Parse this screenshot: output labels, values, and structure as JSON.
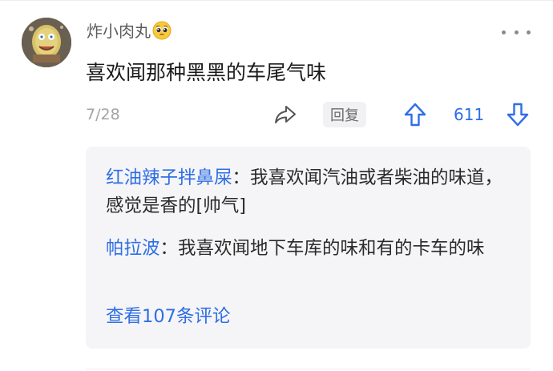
{
  "comment": {
    "username": "炸小肉丸",
    "username_emoji": "pleading-face",
    "text": "喜欢闻那种黑黑的车尾气味",
    "date": "7/28",
    "reply_label": "回复",
    "vote_count": "611"
  },
  "replies": [
    {
      "author": "红油辣子拌鼻屎",
      "separator": "：",
      "text": "我喜欢闻汽油或者柴油的味道，感觉是香的[帅气]"
    },
    {
      "author": "帕拉波",
      "separator": "：",
      "text": "我喜欢闻地下车库的味和有的卡车的味"
    }
  ],
  "view_all_label": "查看107条评论",
  "colors": {
    "accent": "#2f6ee6",
    "muted": "#a3a3a3",
    "reply_bg": "#f5f5f7"
  },
  "icons": {
    "share": "share-arrow-icon",
    "upvote": "arrow-up-icon",
    "downvote": "arrow-down-icon",
    "more": "more-dots-icon"
  }
}
